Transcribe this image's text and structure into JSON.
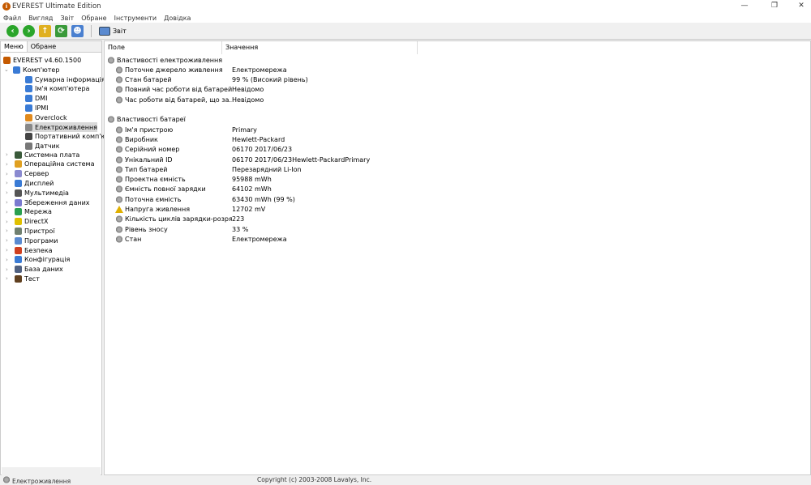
{
  "window": {
    "title": "EVEREST Ultimate Edition",
    "controls": [
      "—",
      "❐",
      "✕"
    ]
  },
  "menu": [
    "Файл",
    "Вигляд",
    "Звіт",
    "Обране",
    "Інструменти",
    "Довідка"
  ],
  "toolbar": {
    "report_label": "Звіт"
  },
  "left": {
    "tabs": [
      "Меню",
      "Обране"
    ],
    "root": "EVEREST v4.60.1500",
    "computer": "Комп'ютер",
    "computer_children": [
      {
        "label": "Сумарна інформація",
        "color": "#3a7bd5"
      },
      {
        "label": "Ім'я комп'ютера",
        "color": "#3a7bd5"
      },
      {
        "label": "DMI",
        "color": "#3a7bd5"
      },
      {
        "label": "IPMI",
        "color": "#3a7bd5"
      },
      {
        "label": "Overclock",
        "color": "#e08a1e"
      },
      {
        "label": "Електроживлення",
        "color": "#888888"
      },
      {
        "label": "Портативний комп'ютер",
        "color": "#444444"
      },
      {
        "label": "Датчик",
        "color": "#777777"
      }
    ],
    "sections": [
      {
        "label": "Системна плата",
        "color": "#3a5a3a"
      },
      {
        "label": "Операційна система",
        "color": "#e0a020"
      },
      {
        "label": "Сервер",
        "color": "#8a8ad0"
      },
      {
        "label": "Дисплей",
        "color": "#3a7bd5"
      },
      {
        "label": "Мультимедіа",
        "color": "#555555"
      },
      {
        "label": "Збереження даних",
        "color": "#7a7ad0"
      },
      {
        "label": "Мережа",
        "color": "#2aa050"
      },
      {
        "label": "DirectX",
        "color": "#e0c000"
      },
      {
        "label": "Пристрої",
        "color": "#708070"
      },
      {
        "label": "Програми",
        "color": "#5a8ad0"
      },
      {
        "label": "Безпека",
        "color": "#d04020"
      },
      {
        "label": "Конфігурація",
        "color": "#3a7bd5"
      },
      {
        "label": "База даних",
        "color": "#506080"
      },
      {
        "label": "Тест",
        "color": "#604020"
      }
    ]
  },
  "table": {
    "headers": [
      "Поле",
      "Значення"
    ],
    "groups": [
      {
        "title": "Властивості електроживлення",
        "rows": [
          {
            "field": "Поточне джерело живлення",
            "value": "Електромережа"
          },
          {
            "field": "Стан батарей",
            "value": "99 % (Високий рівень)"
          },
          {
            "field": "Повний час роботи від батарей",
            "value": "Невідомо"
          },
          {
            "field": "Час роботи від батарей, що за...",
            "value": "Невідомо"
          }
        ]
      },
      {
        "title": "Властивості батареї",
        "rows": [
          {
            "field": "Ім'я пристрою",
            "value": "Primary"
          },
          {
            "field": "Виробник",
            "value": "Hewlett-Packard"
          },
          {
            "field": "Серійний номер",
            "value": "06170 2017/06/23"
          },
          {
            "field": "Унікальний ID",
            "value": "06170 2017/06/23Hewlett-PackardPrimary"
          },
          {
            "field": "Тип батарей",
            "value": "Перезарядний Li-Ion"
          },
          {
            "field": "Проектна ємність",
            "value": "95988 mWh"
          },
          {
            "field": "Ємність повної зарядки",
            "value": "64102 mWh"
          },
          {
            "field": "Поточна ємність",
            "value": "63430 mWh  (99 %)"
          },
          {
            "field": "Напруга живлення",
            "value": "12702 mV",
            "icon": "warning"
          },
          {
            "field": "Кількість циклів зарядки-розря...",
            "value": "223"
          },
          {
            "field": "Рівень зносу",
            "value": "33 %"
          },
          {
            "field": "Стан",
            "value": "Електромережа"
          }
        ]
      }
    ]
  },
  "status": {
    "left": "Електроживлення",
    "right": "Copyright (c) 2003-2008 Lavalys, Inc."
  }
}
